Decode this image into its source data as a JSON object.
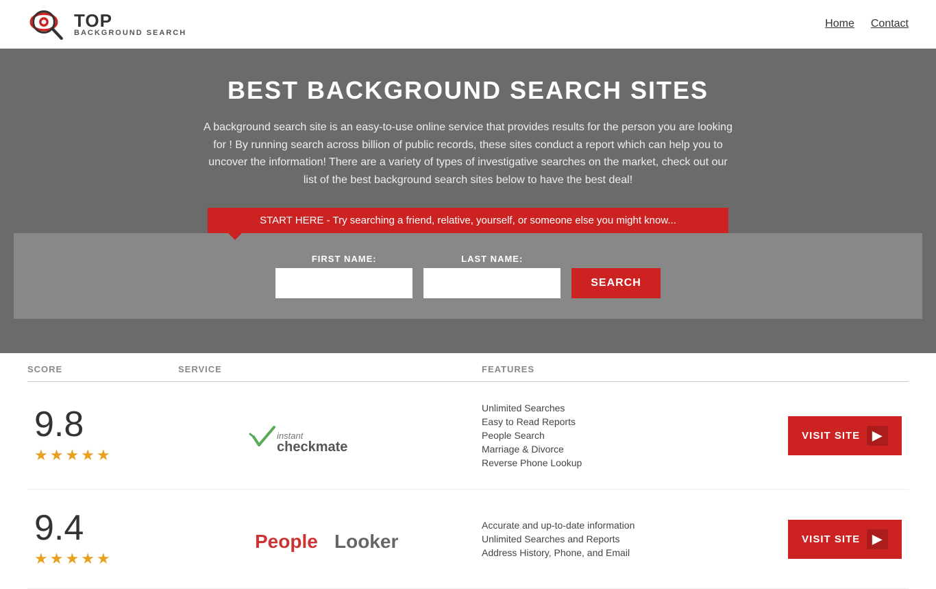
{
  "header": {
    "logo": {
      "top": "TOP",
      "bottom": "BACKGROUND SEARCH"
    },
    "nav": [
      {
        "label": "Home",
        "href": "#"
      },
      {
        "label": "Contact",
        "href": "#"
      }
    ]
  },
  "hero": {
    "title": "BEST BACKGROUND SEARCH SITES",
    "description": "A background search site is an easy-to-use online service that provides results  for the person you are looking for ! By  running  search across billion of public records, these sites conduct  a report which can help you to uncover the information! There are a variety of types of investigative searches on the market, check out our  list of the best background search sites below to have the best deal!",
    "search_banner": "START HERE - Try searching a friend, relative, yourself, or someone else you might know...",
    "form": {
      "first_name_label": "FIRST NAME:",
      "last_name_label": "LAST NAME:",
      "button_label": "SEARCH"
    }
  },
  "table": {
    "headers": {
      "score": "SCORE",
      "service": "SERVICE",
      "features": "FEATURES",
      "action": ""
    },
    "rows": [
      {
        "score": "9.8",
        "stars": 4.5,
        "star_count": 5,
        "service_name": "Instant Checkmate",
        "features": [
          "Unlimited Searches",
          "Easy to Read Reports",
          "People Search",
          "Marriage & Divorce",
          "Reverse Phone Lookup"
        ],
        "visit_label": "VISIT SITE"
      },
      {
        "score": "9.4",
        "stars": 4.5,
        "star_count": 5,
        "service_name": "PeopleLooker",
        "features": [
          "Accurate and up-to-date information",
          "Unlimited Searches and Reports",
          "Address History, Phone, and Email"
        ],
        "visit_label": "VISIT SITE"
      }
    ]
  }
}
